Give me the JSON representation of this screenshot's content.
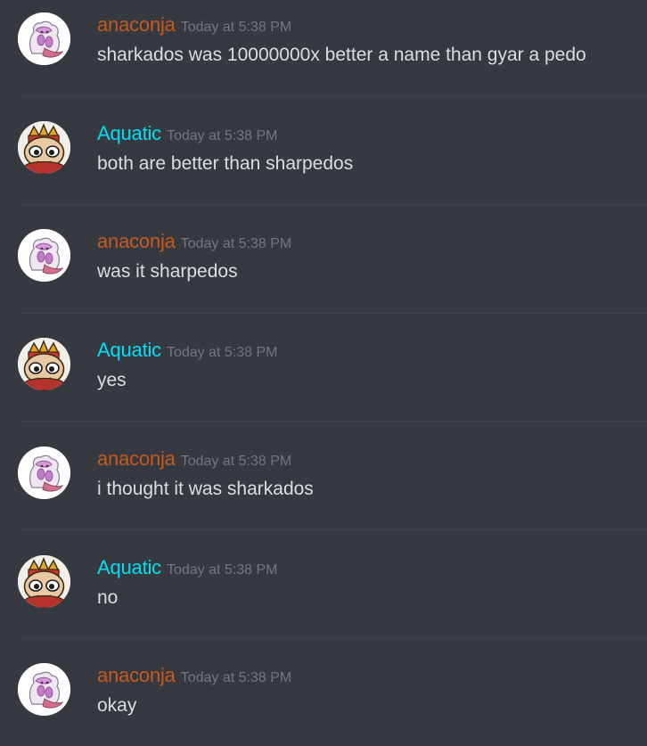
{
  "colors": {
    "background": "#36393f",
    "anaconja": "#c55a1e",
    "aquatic": "#00e0f5",
    "timestamp": "#72767d",
    "text": "#dcddde"
  },
  "messages": [
    {
      "author": "anaconja",
      "avatar": "anaconja-avatar",
      "time": "Today at 5:38 PM",
      "text": "sharkados was 10000000x better a name than gyar a pedo"
    },
    {
      "author": "Aquatic",
      "avatar": "aquatic-avatar",
      "time": "Today at 5:38 PM",
      "text": "both are better than sharpedos"
    },
    {
      "author": "anaconja",
      "avatar": "anaconja-avatar",
      "time": "Today at 5:38 PM",
      "text": "was it sharpedos"
    },
    {
      "author": "Aquatic",
      "avatar": "aquatic-avatar",
      "time": "Today at 5:38 PM",
      "text": "yes"
    },
    {
      "author": "anaconja",
      "avatar": "anaconja-avatar",
      "time": "Today at 5:38 PM",
      "text": "i thought it was sharkados"
    },
    {
      "author": "Aquatic",
      "avatar": "aquatic-avatar",
      "time": "Today at 5:38 PM",
      "text": "no"
    },
    {
      "author": "anaconja",
      "avatar": "anaconja-avatar",
      "time": "Today at 5:38 PM",
      "text": "okay"
    }
  ]
}
